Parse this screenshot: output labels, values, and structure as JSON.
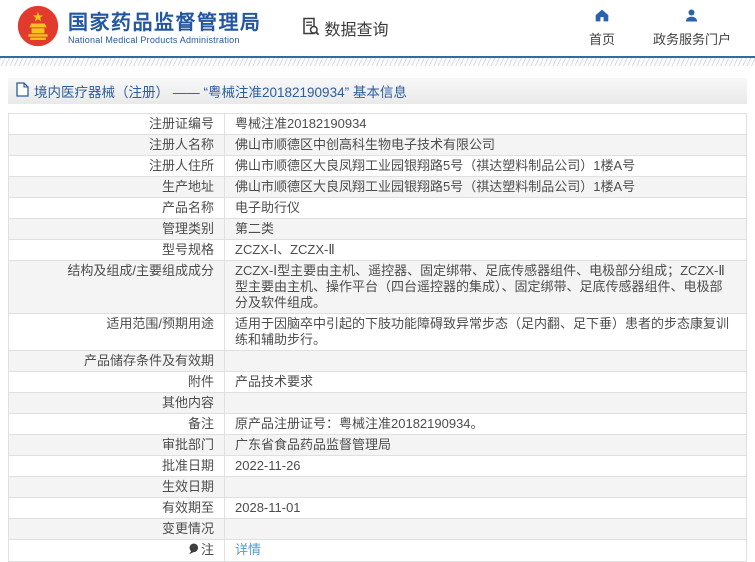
{
  "header": {
    "agency_cn": "国家药品监督管理局",
    "agency_en": "National Medical Products Administration",
    "data_query_label": "数据查询",
    "nav_home_label": "首页",
    "nav_portal_label": "政务服务门户"
  },
  "title_bar": {
    "text": "境内医疗器械（注册） —— “粤械注准20182190934” 基本信息"
  },
  "table": {
    "rows": [
      {
        "label": "注册证编号",
        "value": "粤械注准20182190934"
      },
      {
        "label": "注册人名称",
        "value": "佛山市顺德区中创高科生物电子技术有限公司"
      },
      {
        "label": "注册人住所",
        "value": "佛山市顺德区大良凤翔工业园银翔路5号（祺达塑料制品公司）1楼A号"
      },
      {
        "label": "生产地址",
        "value": "佛山市顺德区大良凤翔工业园银翔路5号（祺达塑料制品公司）1楼A号"
      },
      {
        "label": "产品名称",
        "value": "电子助行仪"
      },
      {
        "label": "管理类别",
        "value": "第二类"
      },
      {
        "label": "型号规格",
        "value": "ZCZX-Ⅰ、ZCZX-Ⅱ"
      },
      {
        "label": "结构及组成/主要组成成分",
        "value": "ZCZX-Ⅰ型主要由主机、遥控器、固定绑带、足底传感器组件、电极部分组成；ZCZX-Ⅱ型主要由主机、操作平台（四台遥控器的集成）、固定绑带、足底传感器组件、电极部分及软件组成。"
      },
      {
        "label": "适用范围/预期用途",
        "value": "适用于因脑卒中引起的下肢功能障碍致异常步态（足内翻、足下垂）患者的步态康复训练和辅助步行。"
      },
      {
        "label": "产品储存条件及有效期",
        "value": ""
      },
      {
        "label": "附件",
        "value": "产品技术要求"
      },
      {
        "label": "其他内容",
        "value": ""
      },
      {
        "label": "备注",
        "value": "原产品注册证号：粤械注准20182190934。"
      },
      {
        "label": "审批部门",
        "value": "广东省食品药品监督管理局"
      },
      {
        "label": "批准日期",
        "value": "2022-11-26"
      },
      {
        "label": "生效日期",
        "value": ""
      },
      {
        "label": "有效期至",
        "value": "2028-11-01"
      },
      {
        "label": "变更情况",
        "value": ""
      },
      {
        "label": "注",
        "value": "详情",
        "value_is_link": true,
        "label_icon": "note-icon"
      }
    ]
  },
  "colors": {
    "brand_blue": "#2457a0",
    "title_blue": "#2d5c9e",
    "separator_blue": "#2e6da4",
    "link_blue": "#509bd8",
    "text": "#4d4d4d",
    "alt_row_bg": "#f4f4f4",
    "border": "#e0e0e0",
    "emblem_red": "#e23a2c",
    "emblem_gold": "#f6c21c"
  }
}
